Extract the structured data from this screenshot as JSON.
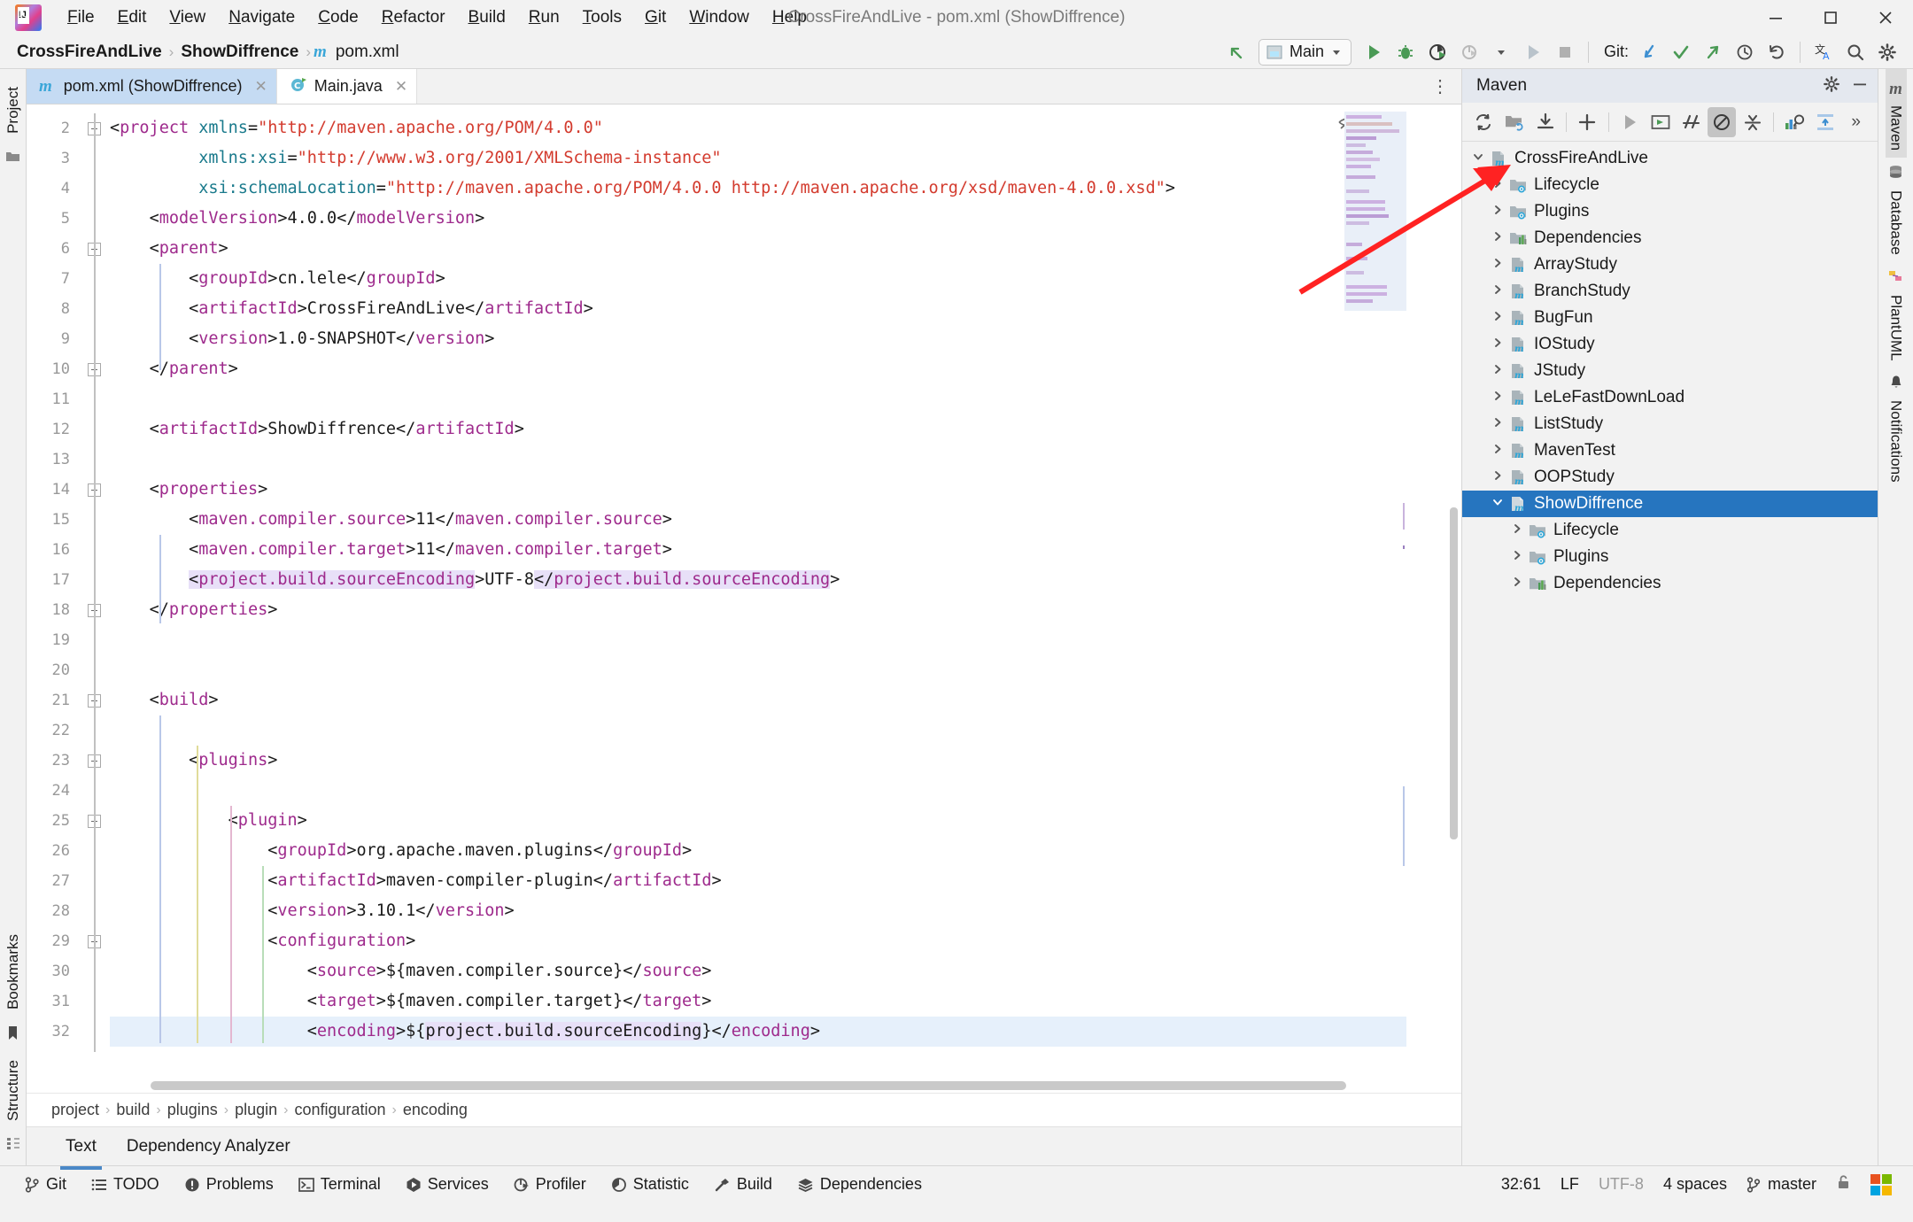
{
  "window": {
    "title": "CrossFireAndLive - pom.xml (ShowDiffrence)",
    "minimize": "—",
    "maximize": "☐",
    "close": "✕"
  },
  "menu": {
    "items": [
      {
        "label": "File"
      },
      {
        "label": "Edit"
      },
      {
        "label": "View"
      },
      {
        "label": "Navigate"
      },
      {
        "label": "Code"
      },
      {
        "label": "Refactor"
      },
      {
        "label": "Build"
      },
      {
        "label": "Run"
      },
      {
        "label": "Tools"
      },
      {
        "label": "Git"
      },
      {
        "label": "Window"
      },
      {
        "label": "Help"
      }
    ]
  },
  "navbar": {
    "crumbs": [
      {
        "label": "CrossFireAndLive",
        "bold": true
      },
      {
        "label": "ShowDiffrence",
        "bold": true
      },
      {
        "label": "pom.xml",
        "bold": false,
        "icon": "maven-file-icon"
      }
    ],
    "separator": "›",
    "run_config": "Main",
    "git_label": "Git:",
    "icons": [
      "back-arrow-icon",
      "run-icon",
      "debug-icon",
      "run-coverage-icon",
      "profile-icon",
      "rerun-icon",
      "stop-icon",
      "git-update-icon",
      "git-commit-icon",
      "git-push-icon",
      "git-history-icon",
      "git-rollback-icon",
      "translate-icon",
      "search-icon",
      "settings-icon"
    ]
  },
  "left_sidebar": {
    "tabs": [
      {
        "label": "Project"
      },
      {
        "label": "Bookmarks"
      },
      {
        "label": "Structure"
      }
    ]
  },
  "editor": {
    "tabs": [
      {
        "label": "pom.xml (ShowDiffrence)",
        "active": true,
        "icon": "maven-file-icon"
      },
      {
        "label": "Main.java",
        "active": false,
        "icon": "java-class-icon"
      }
    ],
    "first_line_number": 2,
    "lines": [
      {
        "n": 2,
        "fold": "open",
        "caret": false
      },
      {
        "n": 3,
        "fold": "",
        "caret": false
      },
      {
        "n": 4,
        "fold": "",
        "caret": false
      },
      {
        "n": 5,
        "fold": "",
        "caret": false
      },
      {
        "n": 6,
        "fold": "open",
        "caret": false,
        "marker": "maven-reimport-icon"
      },
      {
        "n": 7,
        "fold": "",
        "caret": false
      },
      {
        "n": 8,
        "fold": "",
        "caret": false
      },
      {
        "n": 9,
        "fold": "",
        "caret": false
      },
      {
        "n": 10,
        "fold": "close",
        "caret": false
      },
      {
        "n": 11,
        "fold": "",
        "caret": false
      },
      {
        "n": 12,
        "fold": "",
        "caret": false
      },
      {
        "n": 13,
        "fold": "",
        "caret": false
      },
      {
        "n": 14,
        "fold": "open",
        "caret": false
      },
      {
        "n": 15,
        "fold": "",
        "caret": false
      },
      {
        "n": 16,
        "fold": "",
        "caret": false
      },
      {
        "n": 17,
        "fold": "",
        "caret": false
      },
      {
        "n": 18,
        "fold": "close",
        "caret": false
      },
      {
        "n": 19,
        "fold": "",
        "caret": false
      },
      {
        "n": 20,
        "fold": "",
        "caret": false
      },
      {
        "n": 21,
        "fold": "open",
        "caret": false
      },
      {
        "n": 22,
        "fold": "",
        "caret": false
      },
      {
        "n": 23,
        "fold": "open",
        "caret": false
      },
      {
        "n": 24,
        "fold": "",
        "caret": false
      },
      {
        "n": 25,
        "fold": "open",
        "caret": false
      },
      {
        "n": 26,
        "fold": "",
        "caret": false
      },
      {
        "n": 27,
        "fold": "",
        "caret": false
      },
      {
        "n": 28,
        "fold": "",
        "caret": false
      },
      {
        "n": 29,
        "fold": "open",
        "caret": false
      },
      {
        "n": 30,
        "fold": "",
        "caret": false
      },
      {
        "n": 31,
        "fold": "",
        "caret": false
      },
      {
        "n": 32,
        "fold": "",
        "caret": true
      }
    ],
    "breadcrumb": [
      "project",
      "build",
      "plugins",
      "plugin",
      "configuration",
      "encoding"
    ],
    "breadcrumb_sep": "›",
    "bottom_tabs": [
      {
        "label": "Text",
        "selected": true
      },
      {
        "label": "Dependency Analyzer",
        "selected": false
      }
    ]
  },
  "maven": {
    "title": "Maven",
    "header_icons": [
      "gear-icon",
      "minimize-icon"
    ],
    "toolbar_icons": [
      "reload-icon",
      "add-maven-project-icon",
      "download-sources-icon",
      "plus-icon",
      "run-icon",
      "execute-goal-icon",
      "toggle-skip-tests-icon",
      "toggle-offline-icon",
      "collapse-all-icon",
      "show-dependencies-icon",
      "expand-icon",
      "more-icon"
    ],
    "tree": [
      {
        "label": "CrossFireAndLive",
        "depth": 0,
        "arrow": "⌄",
        "icon": "maven-project-icon",
        "selected": false
      },
      {
        "label": "Lifecycle",
        "depth": 1,
        "arrow": "›",
        "icon": "lifecycle-folder-icon",
        "selected": false
      },
      {
        "label": "Plugins",
        "depth": 1,
        "arrow": "›",
        "icon": "plugins-folder-icon",
        "selected": false
      },
      {
        "label": "Dependencies",
        "depth": 1,
        "arrow": "›",
        "icon": "dependencies-folder-icon",
        "selected": false
      },
      {
        "label": "ArrayStudy",
        "depth": 1,
        "arrow": "›",
        "icon": "maven-module-icon",
        "selected": false
      },
      {
        "label": "BranchStudy",
        "depth": 1,
        "arrow": "›",
        "icon": "maven-module-icon",
        "selected": false
      },
      {
        "label": "BugFun",
        "depth": 1,
        "arrow": "›",
        "icon": "maven-module-icon",
        "selected": false
      },
      {
        "label": "IOStudy",
        "depth": 1,
        "arrow": "›",
        "icon": "maven-module-icon",
        "selected": false
      },
      {
        "label": "JStudy",
        "depth": 1,
        "arrow": "›",
        "icon": "maven-module-icon",
        "selected": false
      },
      {
        "label": "LeLeFastDownLoad",
        "depth": 1,
        "arrow": "›",
        "icon": "maven-module-icon",
        "selected": false
      },
      {
        "label": "ListStudy",
        "depth": 1,
        "arrow": "›",
        "icon": "maven-module-icon",
        "selected": false
      },
      {
        "label": "MavenTest",
        "depth": 1,
        "arrow": "›",
        "icon": "maven-module-icon",
        "selected": false
      },
      {
        "label": "OOPStudy",
        "depth": 1,
        "arrow": "›",
        "icon": "maven-module-icon",
        "selected": false
      },
      {
        "label": "ShowDiffrence",
        "depth": 1,
        "arrow": "⌄",
        "icon": "maven-module-icon",
        "selected": true
      },
      {
        "label": "Lifecycle",
        "depth": 2,
        "arrow": "›",
        "icon": "lifecycle-folder-icon",
        "selected": false
      },
      {
        "label": "Plugins",
        "depth": 2,
        "arrow": "›",
        "icon": "plugins-folder-icon",
        "selected": false
      },
      {
        "label": "Dependencies",
        "depth": 2,
        "arrow": "›",
        "icon": "dependencies-folder-icon",
        "selected": false
      }
    ]
  },
  "right_sidebar": {
    "tabs": [
      {
        "label": "Maven",
        "icon": "maven-icon",
        "selected": true
      },
      {
        "label": "Database",
        "icon": "database-icon",
        "selected": false
      },
      {
        "label": "PlantUML",
        "icon": "plantuml-icon",
        "selected": false
      },
      {
        "label": "Notifications",
        "icon": "bell-icon",
        "selected": false
      }
    ]
  },
  "statusbar": {
    "buttons": [
      {
        "label": "Git",
        "icon": "git-branch-icon"
      },
      {
        "label": "TODO",
        "icon": "todo-icon"
      },
      {
        "label": "Problems",
        "icon": "problems-icon"
      },
      {
        "label": "Terminal",
        "icon": "terminal-icon"
      },
      {
        "label": "Services",
        "icon": "services-icon"
      },
      {
        "label": "Profiler",
        "icon": "profiler-icon"
      },
      {
        "label": "Statistic",
        "icon": "statistic-icon"
      },
      {
        "label": "Build",
        "icon": "build-hammer-icon"
      },
      {
        "label": "Dependencies",
        "icon": "dependencies-icon"
      }
    ],
    "caret_position": "32:61",
    "line_separator": "LF",
    "encoding": "UTF-8",
    "indent": "4 spaces",
    "branch": "master",
    "lock": "🔓"
  },
  "colors": {
    "accent_selection": "#2675bf",
    "tab_active": "#c5dbf3",
    "caret_line": "#e6f0fb",
    "identifier_highlight": "#e8e0f8",
    "tag": "#9e2a8c",
    "attribute": "#1a7a8c",
    "string": "#d33b2e",
    "annotation_arrow": "#ff2222"
  }
}
